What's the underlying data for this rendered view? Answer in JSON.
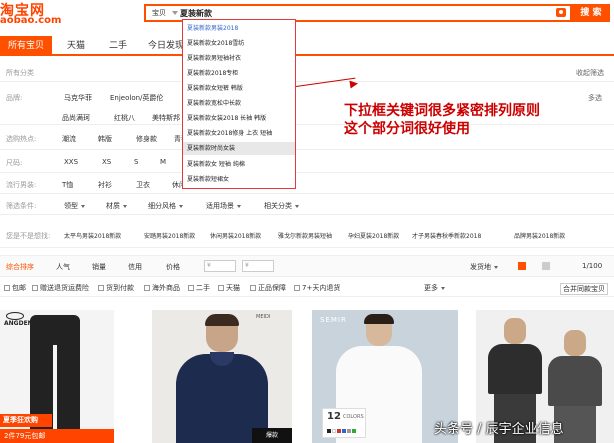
{
  "header": {
    "logo_main": "淘宝网",
    "logo_sub": "aobao.com",
    "search_type": "宝贝",
    "search_value": "夏装新款",
    "search_button": "搜 索"
  },
  "tabs": [
    "所有宝贝",
    "天猫",
    "二手",
    "今日发现"
  ],
  "suggestions": [
    "夏装新款男装2018",
    "夏装新款女2018雪纺",
    "夏装新款男短袖衬衣",
    "夏装新款2018专柜",
    "夏装新款女短裤 韩版",
    "夏装新款宽松中长款",
    "夏装新款女装2018 长袖 韩版",
    "夏装新款女2018修身 上衣 短袖",
    "夏装新款时尚女装",
    "夏装新款女 短袖 纯棉",
    "夏装新款短裙女"
  ],
  "annotation": {
    "line1": "下拉框关键词很多紧密排列原则",
    "line2": "这个部分词很好使用"
  },
  "filters": {
    "all_categories": "所有分类",
    "collapse": "收起筛选",
    "brand_label": "品牌:",
    "brands_row1": [
      "马克华菲",
      "Enjeolon/英爵伦"
    ],
    "brands_row2": [
      "品尚满珂",
      "红桃八",
      "美特斯邦"
    ],
    "brand_more": "多选",
    "hot_label": "选购热点:",
    "hot_items": [
      "潮流",
      "韩版",
      "修身款",
      "青春"
    ],
    "size_label": "尺码:",
    "sizes": [
      "XXS",
      "XS",
      "S",
      "M"
    ],
    "style_label": "流行男装:",
    "style_items": [
      "T恤",
      "衬衫",
      "卫衣",
      "休闲"
    ],
    "cond_label": "筛选条件:",
    "cond_items": [
      "领型",
      "材质",
      "细分风格",
      "适用场景",
      "相关分类"
    ],
    "seek_label": "您是不是想找:",
    "seek_items": [
      "太平鸟男装2018新款",
      "安踏男装2018新款",
      "休闲男装2018新款",
      "雅戈尔新款男装短袖",
      "孕妇夏装2018新款",
      "才子男装春秋季新款2018",
      "品牌男装2018新款"
    ]
  },
  "sortbar": {
    "items": [
      "综合排序",
      "人气",
      "销量",
      "信用",
      "价格"
    ],
    "currency1": "¥",
    "currency2": "¥",
    "ship_from": "发货地",
    "page": "1/100"
  },
  "checks": [
    "包邮",
    "赠送退货运费险",
    "货到付款",
    "海外商品",
    "二手",
    "天猫",
    "正品保障",
    "7+天内退货"
  ],
  "checks_more": "更多",
  "merge_button": "合并同款宝贝",
  "products": {
    "p1_brand": "ANGDENG",
    "p1_badge": "夏季狂欢购",
    "p1_bottom": "2件79元包邮",
    "p2_logo": "MEIDI",
    "p2_badge": "爆款",
    "p3_brand": "SEMIR",
    "p3_num": "12",
    "p3_colors_label": "COLORS"
  },
  "watermark": "头条号 / 辰宇企业信息",
  "colors": {
    "accent": "#ff5000",
    "annotation": "#cc0000"
  }
}
